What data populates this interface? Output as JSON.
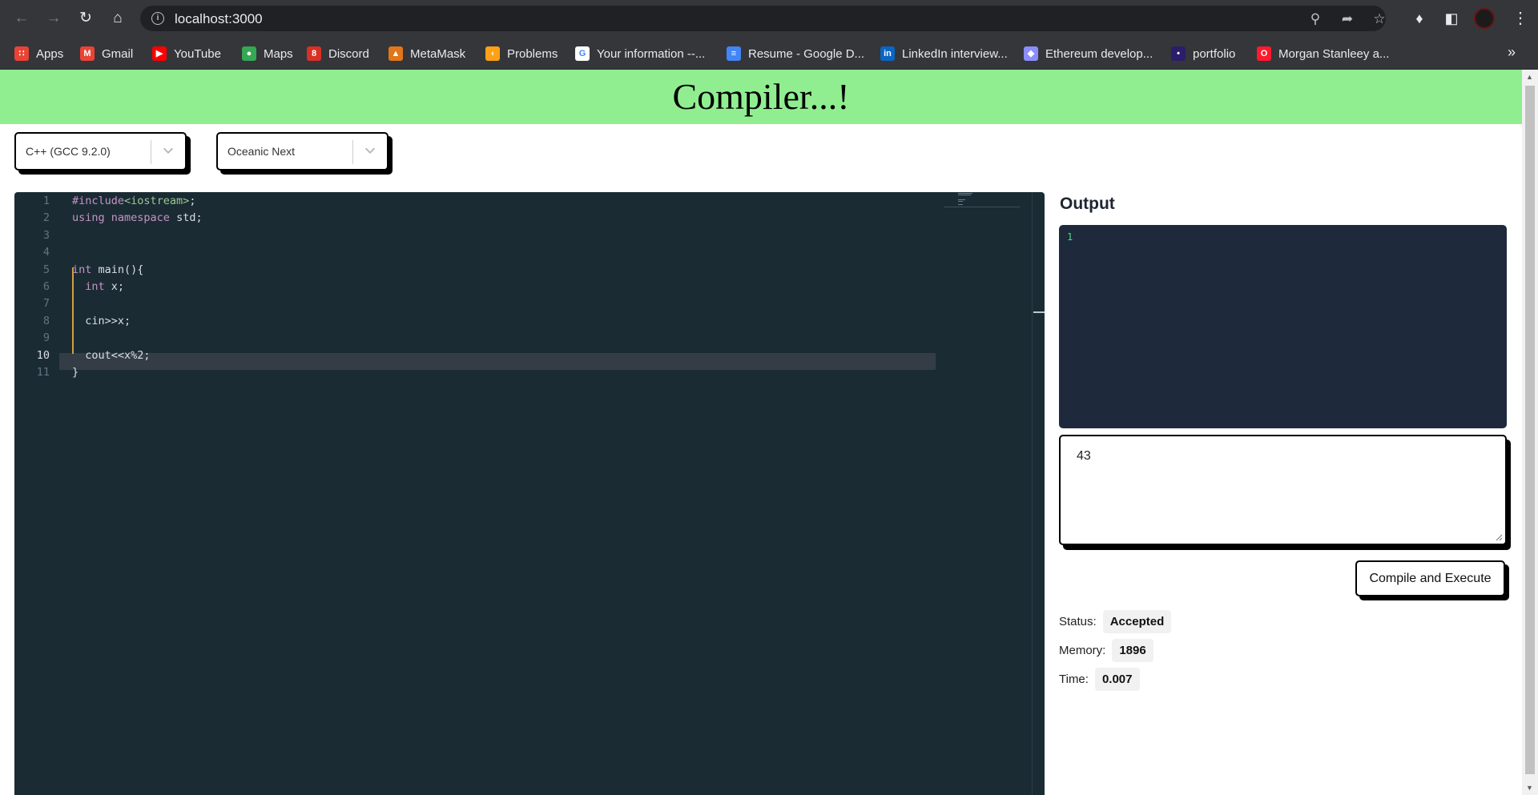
{
  "browser": {
    "url": "localhost:3000",
    "bookmarks": [
      {
        "label": "Apps",
        "icon": "apps-grid-icon",
        "color": "#ea4335"
      },
      {
        "label": "Gmail",
        "icon": "gmail-icon",
        "color": "#ea4335"
      },
      {
        "label": "YouTube",
        "icon": "youtube-icon",
        "color": "#ff0000"
      },
      {
        "label": "Maps",
        "icon": "maps-pin-icon",
        "color": "#34a853"
      },
      {
        "label": "Discord",
        "icon": "discord-icon",
        "color": "#d93025"
      },
      {
        "label": "MetaMask",
        "icon": "metamask-fox-icon",
        "color": "#e2761b"
      },
      {
        "label": "Problems",
        "icon": "leetcode-icon",
        "color": "#ffa116"
      },
      {
        "label": "Your information --...",
        "icon": "google-icon",
        "color": "#ffffff"
      },
      {
        "label": "Resume - Google D...",
        "icon": "google-docs-icon",
        "color": "#4285f4"
      },
      {
        "label": "LinkedIn interview...",
        "icon": "linkedin-icon",
        "color": "#0a66c2"
      },
      {
        "label": "Ethereum develop...",
        "icon": "ethereum-icon",
        "color": "#8c8dfc"
      },
      {
        "label": "portfolio",
        "icon": "portfolio-icon",
        "color": "#2b1d6b"
      },
      {
        "label": "Morgan Stanleey a...",
        "icon": "opera-icon",
        "color": "#ff1b2d"
      }
    ]
  },
  "header": {
    "title": "Compiler...!"
  },
  "controls": {
    "language": "C++ (GCC 9.2.0)",
    "theme": "Oceanic Next"
  },
  "editor": {
    "lines": [
      {
        "n": "1",
        "html": "<span class=\"kw\">#include</span><span class=\"str\">&lt;iostream&gt;</span>;"
      },
      {
        "n": "2",
        "html": "<span class=\"kw\">using</span> <span class=\"kw\">namespace</span> std;"
      },
      {
        "n": "3",
        "html": ""
      },
      {
        "n": "4",
        "html": ""
      },
      {
        "n": "5",
        "html": "<span class=\"kw\">int</span> main(){"
      },
      {
        "n": "6",
        "html": "  <span class=\"kw\">int</span> x;"
      },
      {
        "n": "7",
        "html": ""
      },
      {
        "n": "8",
        "html": "  cin&gt;&gt;x;"
      },
      {
        "n": "9",
        "html": ""
      },
      {
        "n": "10",
        "html": "  cout&lt;&lt;x%2;"
      },
      {
        "n": "11",
        "html": "}"
      }
    ],
    "active_line": "10"
  },
  "output": {
    "title": "Output",
    "line_number": "1",
    "input_value": "43"
  },
  "compile_button": "Compile and Execute",
  "result": {
    "status_label": "Status:",
    "status_value": "Accepted",
    "memory_label": "Memory:",
    "memory_value": "1896",
    "time_label": "Time:",
    "time_value": "0.007"
  },
  "colors": {
    "header_bg": "#90ee90",
    "editor_bg": "#1b2b34",
    "output_bg": "#1e293b"
  }
}
